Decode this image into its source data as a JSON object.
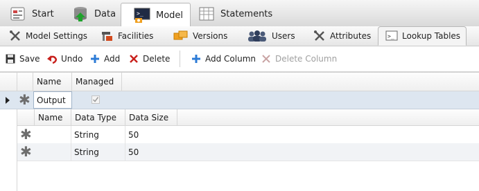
{
  "top_tabs": [
    {
      "label": "Start",
      "icon": "start-icon"
    },
    {
      "label": "Data",
      "icon": "data-icon"
    },
    {
      "label": "Model",
      "icon": "model-icon",
      "active": true
    },
    {
      "label": "Statements",
      "icon": "statements-icon"
    }
  ],
  "sub_tabs": [
    {
      "label": "Model Settings",
      "icon": "wrench-icon"
    },
    {
      "label": "Facilities",
      "icon": "facilities-icon"
    },
    {
      "label": "Versions",
      "icon": "versions-icon"
    },
    {
      "label": "Users",
      "icon": "users-icon"
    },
    {
      "label": "Attributes",
      "icon": "wrench-icon"
    },
    {
      "label": "Lookup Tables",
      "icon": "lookup-table-icon",
      "active": true
    }
  ],
  "toolbar": {
    "save": "Save",
    "undo": "Undo",
    "add": "Add",
    "delete": "Delete",
    "add_column": "Add Column",
    "delete_column": "Delete Column"
  },
  "tables_grid": {
    "headers": [
      "Name",
      "Managed"
    ],
    "rows": [
      {
        "name": "Output",
        "managed": true
      }
    ]
  },
  "columns_grid": {
    "headers": [
      "Name",
      "Data Type",
      "Data Size"
    ],
    "rows": [
      {
        "name": "",
        "data_type": "String",
        "data_size": "50"
      },
      {
        "name": "",
        "data_type": "String",
        "data_size": "50"
      }
    ]
  },
  "colors": {
    "accent_blue": "#2c7bd6",
    "delete_red": "#c8201c",
    "selected_row": "#dde6f0"
  }
}
